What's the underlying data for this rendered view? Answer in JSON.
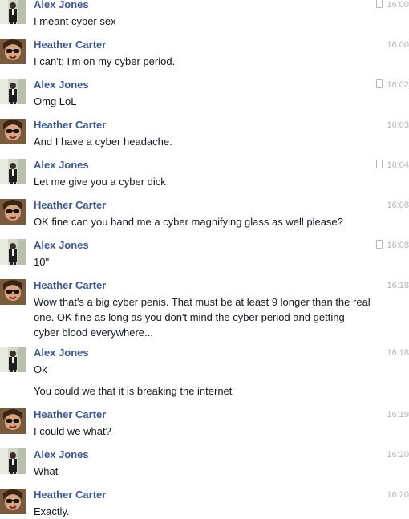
{
  "contacts": {
    "alex": {
      "name": "Alex Jones"
    },
    "heather": {
      "name": "Heather Carter"
    }
  },
  "messages": [
    {
      "sender": "alex",
      "time": "16:00",
      "mobile": true,
      "lines": [
        "I meant cyber sex"
      ]
    },
    {
      "sender": "heather",
      "time": "16:00",
      "mobile": false,
      "lines": [
        "I can't; I'm on my cyber period."
      ]
    },
    {
      "sender": "alex",
      "time": "16:02",
      "mobile": true,
      "lines": [
        "Omg LoL"
      ]
    },
    {
      "sender": "heather",
      "time": "16:03",
      "mobile": false,
      "lines": [
        "And I have a cyber headache."
      ]
    },
    {
      "sender": "alex",
      "time": "16:04",
      "mobile": true,
      "lines": [
        "Let me give you a cyber dick"
      ]
    },
    {
      "sender": "heather",
      "time": "16:08",
      "mobile": false,
      "lines": [
        "OK fine can you hand me a cyber magnifying glass as well please?"
      ]
    },
    {
      "sender": "alex",
      "time": "16:08",
      "mobile": true,
      "lines": [
        "10\""
      ]
    },
    {
      "sender": "heather",
      "time": "16:18",
      "mobile": false,
      "lines": [
        "Wow that's a big cyber penis. That must be at least 9 longer than the real one. OK fine as long as you don't mind the cyber period and getting cyber blood everywhere..."
      ]
    },
    {
      "sender": "alex",
      "time": "16:18",
      "mobile": false,
      "lines": [
        "Ok",
        "You could we that it is breaking the internet"
      ]
    },
    {
      "sender": "heather",
      "time": "16:19",
      "mobile": false,
      "lines": [
        "I could we what?"
      ]
    },
    {
      "sender": "alex",
      "time": "16:20",
      "mobile": false,
      "lines": [
        "What"
      ]
    },
    {
      "sender": "heather",
      "time": "16:20",
      "mobile": false,
      "lines": [
        "Exactly."
      ]
    }
  ],
  "colors": {
    "name": "#3b5998",
    "text": "#141823",
    "time": "#b5b5b5"
  }
}
